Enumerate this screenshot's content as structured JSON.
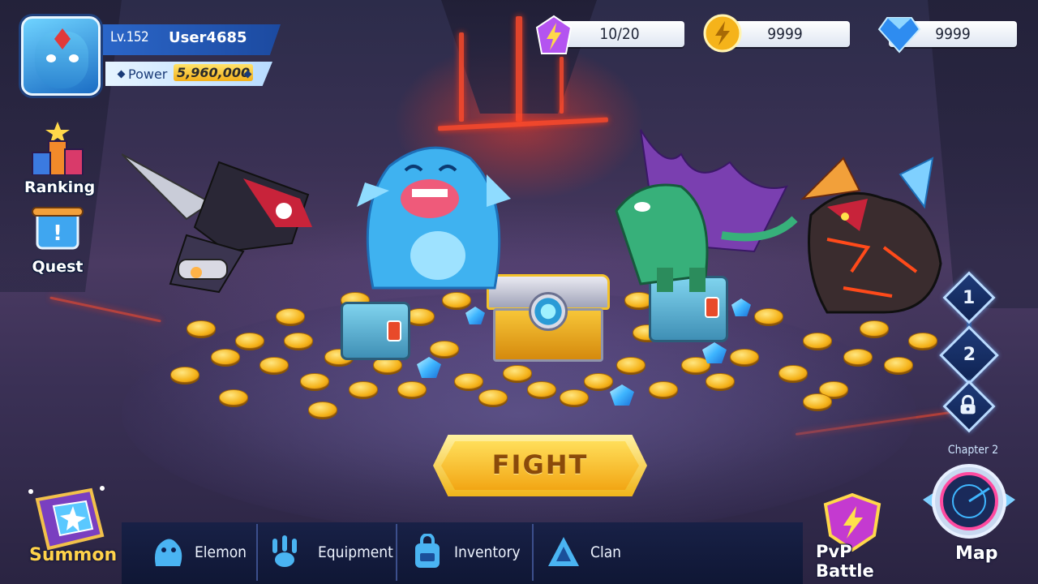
{
  "player": {
    "level": "Lv.152",
    "username": "User4685",
    "power_label": "Power",
    "power_value": "5,960,000",
    "avatar": "blue-dragon-avatar"
  },
  "resources": {
    "energy": {
      "icon": "lightning-crystal-icon",
      "value": "10/20"
    },
    "gold": {
      "icon": "gold-coin-icon",
      "value": "9999"
    },
    "gems": {
      "icon": "blue-diamond-icon",
      "value": "9999"
    }
  },
  "side_menu": {
    "ranking": "Ranking",
    "quest": "Quest"
  },
  "stages": [
    "1",
    "2"
  ],
  "stage_locked_icon": "lock-icon",
  "fight_label": "FIGHT",
  "bottom_nav": {
    "summon": "Summon",
    "elemon": "Elemon",
    "equipment": "Equipment",
    "inventory": "Inventory",
    "clan": "Clan",
    "pvp": "PvP Battle",
    "map": "Map"
  },
  "chapter": "Chapter 2",
  "colors": {
    "accent_blue": "#1c4aa0",
    "gold": "#f3b01a",
    "fight_text": "#8a4a0a"
  }
}
